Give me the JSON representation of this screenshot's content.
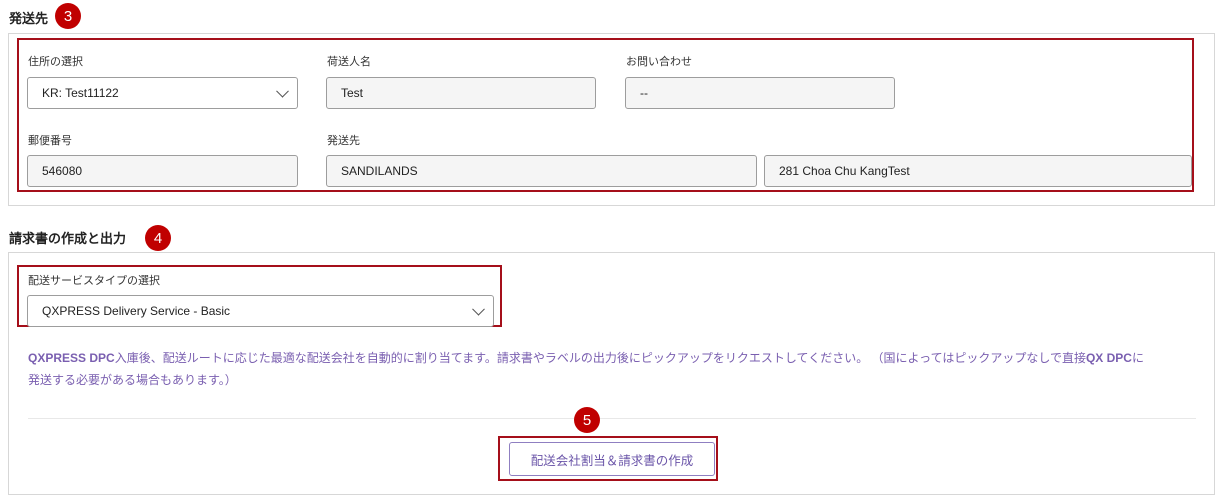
{
  "shipping": {
    "title": "発送先",
    "badge": "3",
    "address_select": {
      "label": "住所の選択",
      "value": "KR: Test11122"
    },
    "shipper_name": {
      "label": "荷送人名",
      "value": "Test"
    },
    "contact": {
      "label": "お問い合わせ",
      "value": "--"
    },
    "postal_code": {
      "label": "郵便番号",
      "value": "546080"
    },
    "destination": {
      "label": "発送先",
      "value1": "SANDILANDS",
      "value2": "281 Choa Chu KangTest"
    }
  },
  "invoice": {
    "title": "請求書の作成と出力",
    "badge": "4",
    "service_type": {
      "label": "配送サービスタイプの選択",
      "value": "QXPRESS Delivery Service - Basic"
    },
    "notice_bold1": "QXPRESS DPC",
    "notice_text1": "入庫後、配送ルートに応じた最適な配送会社を自動的に割り当てます。請求書やラベルの出力後にピックアップをリクエストしてください。 （国によってはピックアップなしで直接",
    "notice_bold2": "QX DPC",
    "notice_text2": "に",
    "notice_line2": "発送する必要がある場合もあります。）",
    "action_badge": "5",
    "action_button": "配送会社割当＆請求書の作成"
  },
  "colors": {
    "badge": "#c00000",
    "highlight_border": "#a50f1a",
    "notice_text": "#7a5fb0",
    "button_text": "#6a54a8"
  },
  "icons": [
    "chevron-down-icon"
  ]
}
